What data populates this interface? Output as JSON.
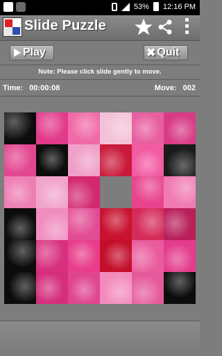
{
  "status_bar": {
    "battery_percent": "53%",
    "time": "12:16 PM"
  },
  "app": {
    "title": "Slide Puzzle"
  },
  "toolbar": {
    "play_label": "Play",
    "quit_label": "Quit"
  },
  "note": "Note: Please click slide gently to move.",
  "stats": {
    "time_label": "Time:",
    "time_value": "00:00:08",
    "move_label": "Move:",
    "move_value": "002"
  },
  "puzzle": {
    "grid": 6,
    "empty_row": 2,
    "empty_col": 3,
    "colors": {
      "rose_pink": "#e2367f",
      "rose_light": "#f07ab2",
      "rose_red": "#c40f2c",
      "background": "#0c0c0c"
    },
    "tiles": [
      [
        "#0c0c0c",
        "#e23a8a",
        "#f06aa8",
        "#f4c2d8",
        "#e85fa0",
        "#d83b86"
      ],
      [
        "#e2468f",
        "#0c0c0c",
        "#f0a0c8",
        "#c91a3a",
        "#f25aa2",
        "#1a1a1a"
      ],
      [
        "#ee7fb4",
        "#f1a5cc",
        "#d3286f",
        "#7d7d7d",
        "#e8448e",
        "#f07ab2"
      ],
      [
        "#0c0c0c",
        "#f08cc0",
        "#e24c94",
        "#c81230",
        "#d52b5a",
        "#b8205a"
      ],
      [
        "#0c0c0c",
        "#d8307e",
        "#e83d8a",
        "#c40f2c",
        "#ea5b9e",
        "#e23c8c"
      ],
      [
        "#0c0c0c",
        "#d52e7c",
        "#e04590",
        "#f28bbc",
        "#e55a9c",
        "#0c0c0c"
      ]
    ]
  }
}
